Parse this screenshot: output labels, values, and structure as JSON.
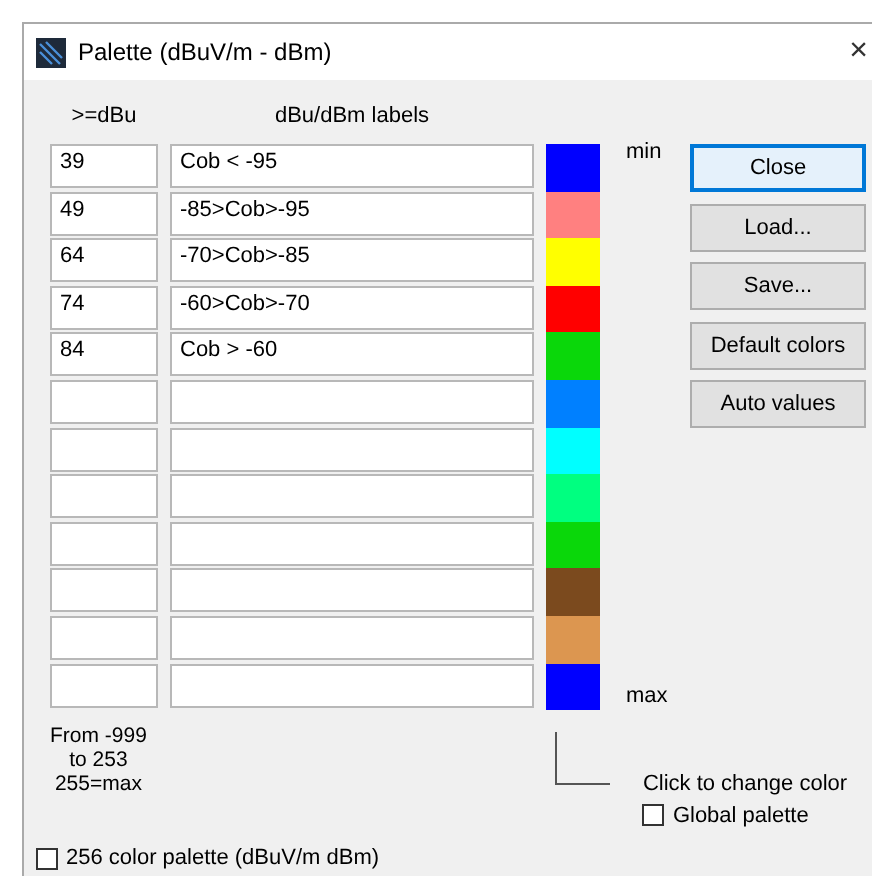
{
  "window": {
    "title": "Palette (dBuV/m - dBm)",
    "close": "×"
  },
  "columns": {
    "value": ">=dBu",
    "label": "dBu/dBm labels"
  },
  "rows": [
    {
      "value": "39",
      "label": "Cob < -95",
      "color": "#0000ff"
    },
    {
      "value": "49",
      "label": "-85>Cob>-95",
      "color": "#ff8080"
    },
    {
      "value": "64",
      "label": "-70>Cob>-85",
      "color": "#ffff00"
    },
    {
      "value": "74",
      "label": "-60>Cob>-70",
      "color": "#ff0000"
    },
    {
      "value": "84",
      "label": "Cob > -60",
      "color": "#0ad70a"
    },
    {
      "value": "",
      "label": "",
      "color": "#0080ff"
    },
    {
      "value": "",
      "label": "",
      "color": "#00ffff"
    },
    {
      "value": "",
      "label": "",
      "color": "#00ff80"
    },
    {
      "value": "",
      "label": "",
      "color": "#0ad70a"
    },
    {
      "value": "",
      "label": "",
      "color": "#7b4a1e"
    },
    {
      "value": "",
      "label": "",
      "color": "#dc9650"
    },
    {
      "value": "",
      "label": "",
      "color": "#0000ff"
    }
  ],
  "scale": {
    "min": "min",
    "max": "max"
  },
  "buttons": [
    {
      "label": "Close",
      "selected": true
    },
    {
      "label": "Load...",
      "selected": false
    },
    {
      "label": "Save...",
      "selected": false
    },
    {
      "label": "Default colors",
      "selected": false
    },
    {
      "label": "Auto values",
      "selected": false
    }
  ],
  "range_note": [
    "From -999",
    "to 253",
    "255=max"
  ],
  "hint": "Click to change color",
  "global_palette": {
    "label": "Global palette",
    "checked": false
  },
  "palette_256": {
    "label": "256 color palette (dBuV/m dBm)",
    "checked": false
  }
}
